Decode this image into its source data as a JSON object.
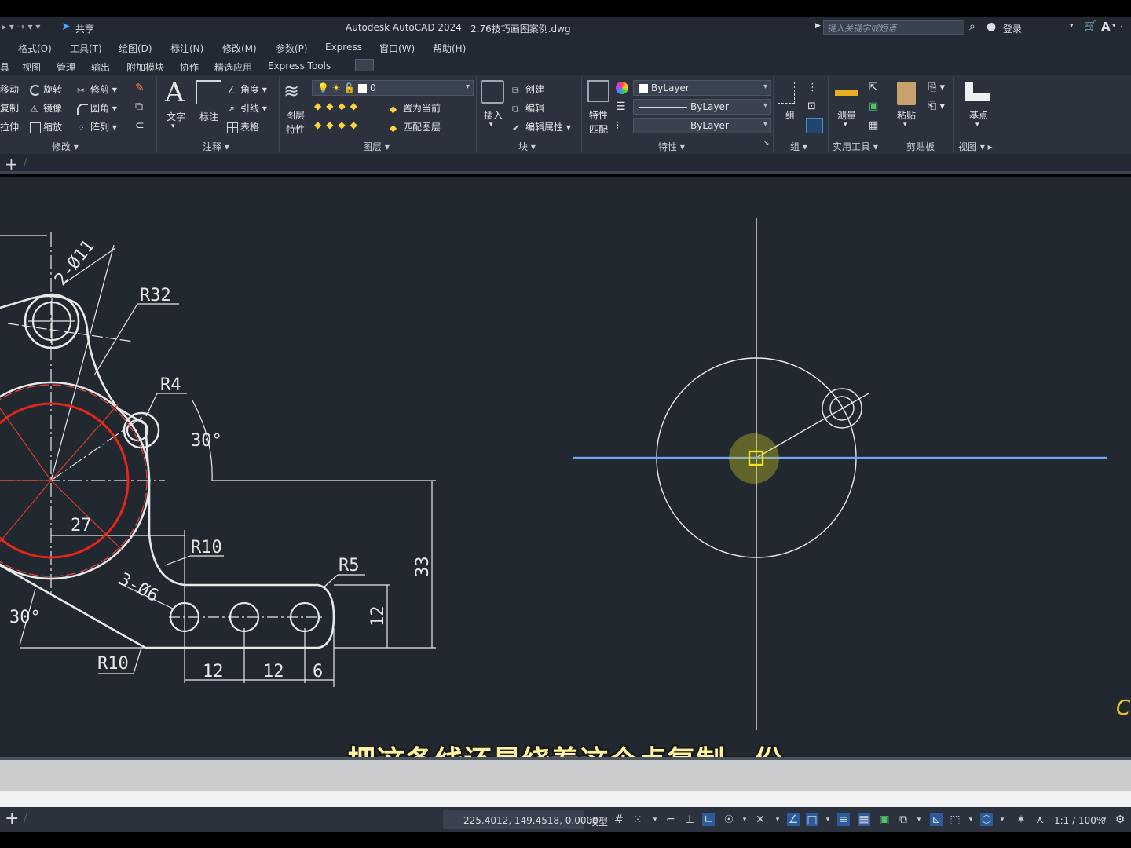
{
  "app": {
    "title": "Autodesk AutoCAD 2024",
    "file_name": "2.76技巧画图案例.dwg",
    "share_label": "共享",
    "search_placeholder": "键入关键字或短语",
    "login_label": "登录"
  },
  "menubar": [
    "格式(O)",
    "工具(T)",
    "绘图(D)",
    "标注(N)",
    "修改(M)",
    "参数(P)",
    "Express",
    "窗口(W)",
    "帮助(H)"
  ],
  "ribbon_tabs": [
    "具",
    "视图",
    "管理",
    "输出",
    "附加模块",
    "协作",
    "精选应用",
    "Express Tools"
  ],
  "ribbon": {
    "modify": {
      "title": "修改",
      "items": [
        "移动",
        "旋转",
        "修剪",
        "复制",
        "镜像",
        "圆角",
        "拉伸",
        "缩放",
        "阵列"
      ]
    },
    "annotation": {
      "title": "注释",
      "text_label": "文字",
      "dim_label": "标注",
      "items": [
        "角度",
        "引线",
        "表格"
      ]
    },
    "layers": {
      "title": "图层",
      "props_label": "图层特性",
      "props_label_line1": "图层",
      "props_label_line2": "特性",
      "current_layer": "0",
      "set_current": "置为当前",
      "match_layer": "匹配图层"
    },
    "block": {
      "title": "块",
      "insert_label": "插入",
      "items": [
        "创建",
        "编辑",
        "编辑属性"
      ]
    },
    "properties": {
      "title": "特性",
      "match_label_line1": "特性",
      "match_label_line2": "匹配",
      "color": "ByLayer",
      "linetype": "ByLayer",
      "lineweight": "ByLayer"
    },
    "groups": {
      "title": "组",
      "label": "组"
    },
    "utilities": {
      "title": "实用工具",
      "measure_label": "测量"
    },
    "clipboard": {
      "title": "剪贴板",
      "paste_label": "粘贴"
    },
    "view": {
      "title": "视图",
      "base_label": "基点"
    }
  },
  "drawing": {
    "dims": [
      "2-Ø11",
      "R32",
      "R4",
      "30°",
      "27",
      "R10",
      "R5",
      "33",
      "3-Ø6",
      "12",
      "30°",
      "R10",
      "12",
      "12",
      "6"
    ],
    "edge_char": "C"
  },
  "subtitle": "把这条线还是绕着这个点复制一份",
  "statusbar": {
    "coords": "225.4012, 149.4518, 0.0000",
    "model_label": "模型",
    "scale_label": "1:1 / 100%"
  }
}
